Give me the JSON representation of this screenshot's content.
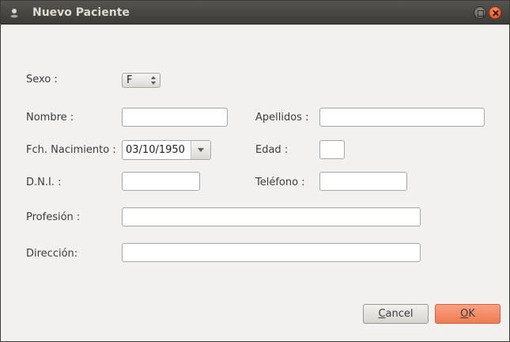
{
  "window": {
    "title": "Nuevo Paciente"
  },
  "form": {
    "sexo": {
      "label": "Sexo :",
      "value": "F"
    },
    "nombre": {
      "label": "Nombre :",
      "value": ""
    },
    "apellidos": {
      "label": "Apellidos :",
      "value": ""
    },
    "fecha": {
      "label": "Fch. Nacimiento :",
      "value": "03/10/1950"
    },
    "edad": {
      "label": "Edad :",
      "value": ""
    },
    "dni": {
      "label": "D.N.I. :",
      "value": ""
    },
    "telefono": {
      "label": "Teléfono :",
      "value": ""
    },
    "profesion": {
      "label": "Profesión :",
      "value": ""
    },
    "direccion": {
      "label": "Dirección:",
      "value": ""
    }
  },
  "buttons": {
    "cancel_mnemonic": "C",
    "cancel_rest": "ancel",
    "ok_mnemonic": "O",
    "ok_rest": "K"
  },
  "colors": {
    "titlebar": "#3c3b37",
    "background": "#f2f1f0",
    "ok_button": "#ee7c53",
    "close_button": "#df4a16"
  },
  "icons": {
    "window_icon": "app-icon",
    "maximize": "maximize-icon",
    "close": "close-icon",
    "combo": "chevron-down-icon",
    "spin": "spin-arrows-icon"
  }
}
